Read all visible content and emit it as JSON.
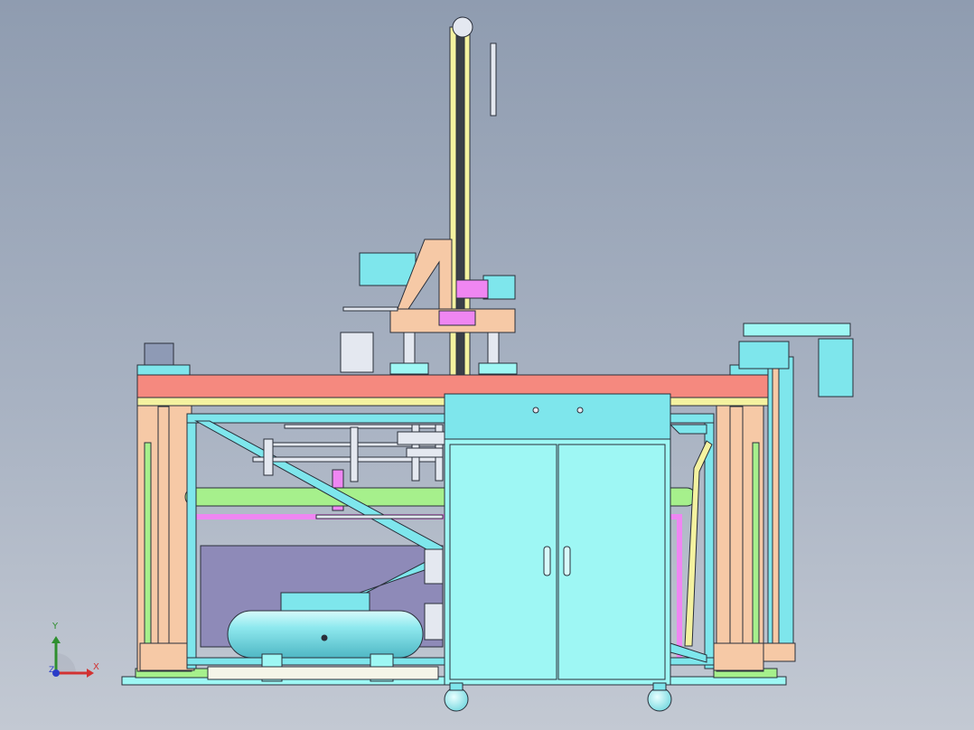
{
  "viewport": {
    "background_top": "#8f9cb0",
    "background_bottom": "#c3c9d3"
  },
  "colors": {
    "salmon": "#f5897f",
    "peach": "#f6c9a6",
    "light_green": "#a6f08c",
    "cyan": "#7ee6ec",
    "pale_cyan": "#9ef7f4",
    "magenta": "#ef86f2",
    "lavender": "#8e8ab8",
    "yellow": "#f4f2a0",
    "outline": "#2a2f3a"
  },
  "triad": {
    "x_label": "X",
    "y_label": "Y",
    "z_label": "Z",
    "x_color": "#d23232",
    "y_color": "#2f8f2f",
    "z_color": "#2a3cc8"
  }
}
